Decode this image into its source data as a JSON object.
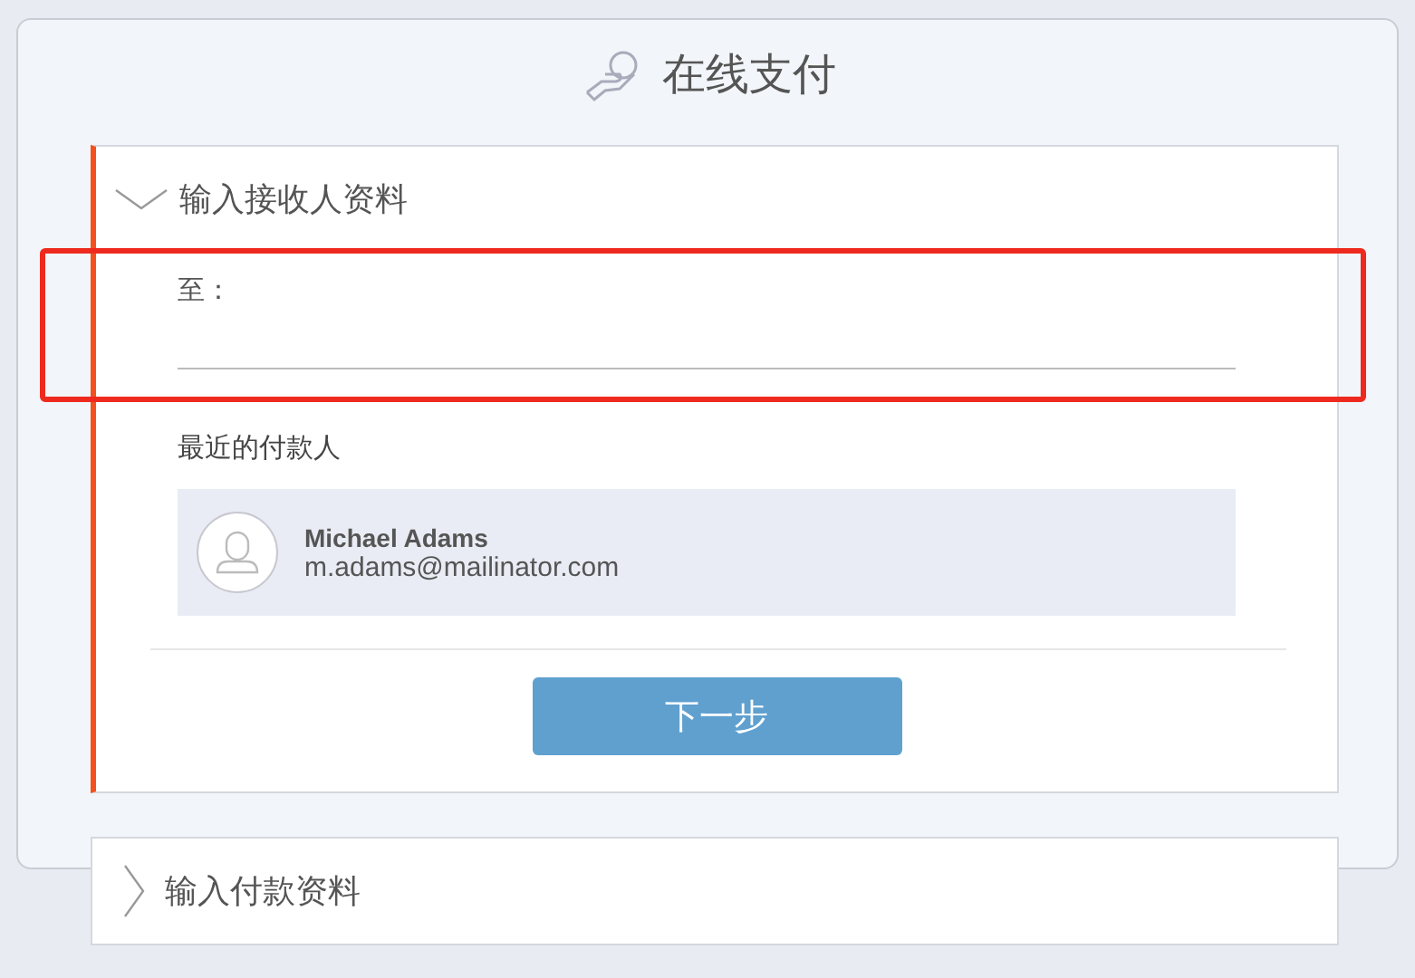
{
  "title": "在线支付",
  "sections": [
    {
      "heading": "输入接收人资料",
      "expanded": true,
      "field": {
        "label": "至：",
        "highlighted": true
      },
      "recent": {
        "heading": "最近的付款人",
        "payees": [
          {
            "name": "Michael Adams",
            "email": "m.adams@mailinator.com"
          }
        ]
      },
      "button": "下一步"
    },
    {
      "heading": "输入付款资料",
      "expanded": false
    }
  ]
}
